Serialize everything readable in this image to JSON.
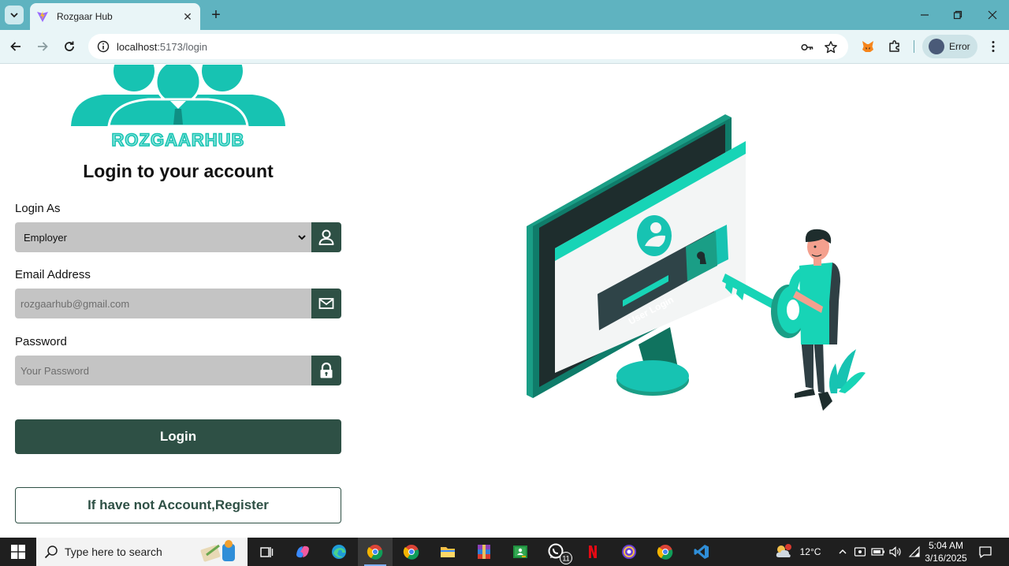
{
  "browser": {
    "tab": {
      "title": "Rozgaar Hub"
    },
    "address": {
      "host": "localhost",
      "path": ":5173/login"
    },
    "profile": {
      "label": "Error"
    }
  },
  "page": {
    "logo_text": "ROZGAARHUB",
    "heading": "Login to your account",
    "login_as": {
      "label": "Login As",
      "selected": "Employer",
      "options": [
        "Employer"
      ]
    },
    "email": {
      "label": "Email Address",
      "placeholder": "rozgaarhub@gmail.com"
    },
    "password": {
      "label": "Password",
      "placeholder": "Your Password"
    },
    "login_button": "Login",
    "register_button": "If have not Account,Register",
    "illustration_caption": "User Login",
    "colors": {
      "primary": "#2e5045",
      "accent": "#17c3b2",
      "input_bg": "#c4c4c4"
    }
  },
  "taskbar": {
    "search_placeholder": "Type here to search",
    "weather": "12°C",
    "whatsapp_badge": "11",
    "time": "5:04 AM",
    "date": "3/16/2025",
    "apps": [
      "task-view",
      "copilot",
      "edge",
      "chrome",
      "chrome-2",
      "file-explorer",
      "winrar",
      "classroom",
      "whatsapp",
      "netflix",
      "podcasts",
      "chrome-3",
      "vscode"
    ]
  }
}
